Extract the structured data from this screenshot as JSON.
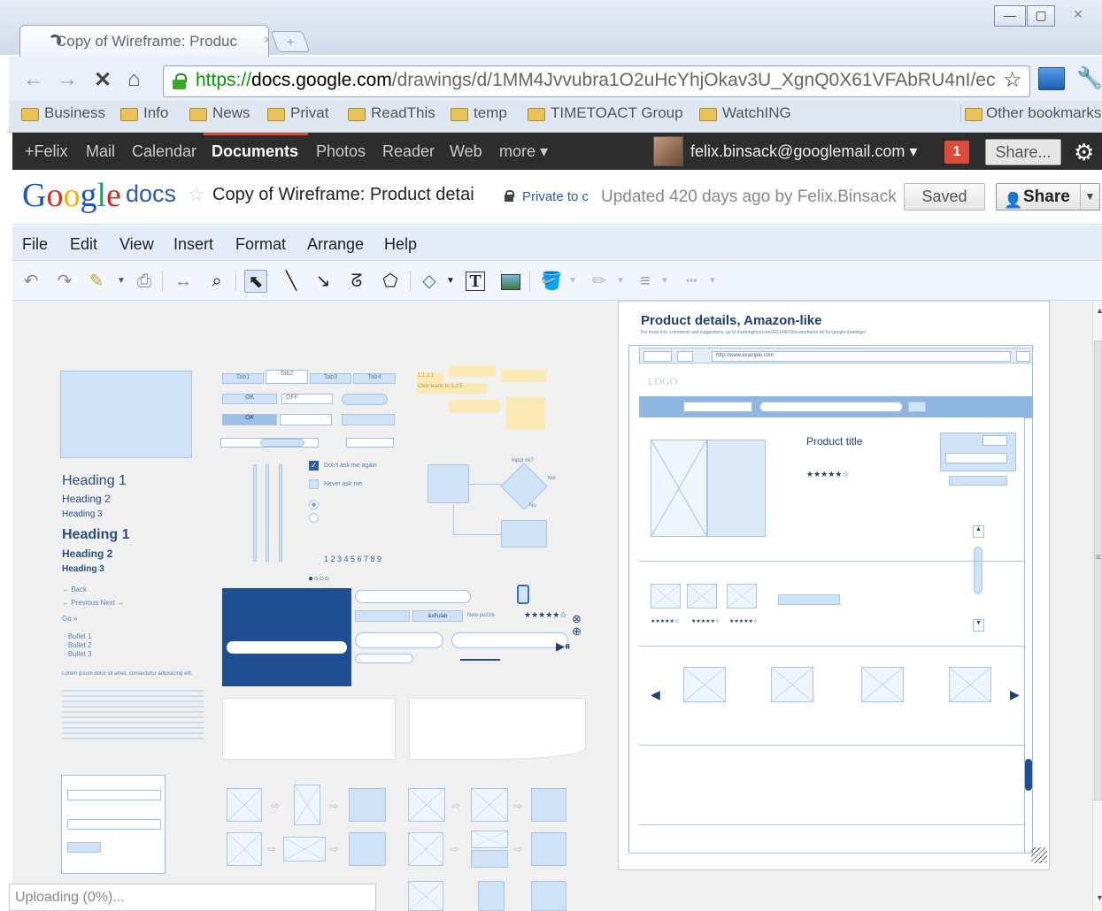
{
  "browser": {
    "tab_title": "Copy of Wireframe: Produc",
    "tab_close": "×",
    "new_tab": "+",
    "window_buttons": [
      "—",
      "▢",
      "✕"
    ],
    "url_scheme": "https://",
    "url_host": "docs.google.com",
    "url_path": "/drawings/d/1MM4Jvvubra1O2uHcYhjOkav3U_XgnQ0X61VFAbRU4nI/ec",
    "nav_icons": [
      "back-icon",
      "forward-icon",
      "stop-icon",
      "home-icon"
    ],
    "bookmarks": [
      "Business",
      "Info",
      "News",
      "Privat",
      "ReadThis",
      "temp",
      "TIMETOACT Group",
      "WatchING"
    ],
    "other_bookmarks": "Other bookmarks"
  },
  "gbar": {
    "links": [
      "+Felix",
      "Mail",
      "Calendar",
      "Documents",
      "Photos",
      "Reader",
      "Web",
      "more ▾"
    ],
    "active": "Documents",
    "user": "felix.binsack@googlemail.com ▾",
    "notifications": "1",
    "share": "Share..."
  },
  "docheader": {
    "logo": [
      "G",
      "o",
      "o",
      "g",
      "l",
      "e"
    ],
    "product": "docs",
    "title": "Copy of Wireframe: Product detai",
    "privacy": "Private to c",
    "updated": "Updated 420 days ago by Felix.Binsack",
    "saved": "Saved",
    "share": "Share"
  },
  "menu": [
    "File",
    "Edit",
    "View",
    "Insert",
    "Format",
    "Arrange",
    "Help"
  ],
  "toolbar_icons": [
    "undo-icon",
    "redo-icon",
    "paint-format-icon",
    "print-icon",
    "fit-icon",
    "zoom-icon",
    "select-icon",
    "line-icon",
    "arrow-icon",
    "curve-icon",
    "polyline-icon",
    "shape-icon",
    "textbox-icon",
    "image-icon",
    "fill-color-icon",
    "line-color-icon",
    "line-weight-icon",
    "line-dash-icon"
  ],
  "palette": {
    "tabs": [
      "Tab1",
      "Tab2",
      "Tab3",
      "Tab4"
    ],
    "ok": "OK",
    "off": "OFF",
    "note": "1.1.1.1",
    "note2": "Click leads to 1.3.5",
    "checkbox1": "Don't ask me again",
    "checkbox2": "Never ask me",
    "pagination": "1 2 3 4 5 6 7 8 9",
    "input_q": "Input ok?",
    "yes": "Yes",
    "no": "No",
    "headings_light": [
      "Heading 1",
      "Heading 2",
      "Heading 3"
    ],
    "headings_bold": [
      "Heading 1",
      "Heading 2",
      "Heading 3"
    ],
    "back": "← Back",
    "prevnext": "← Previous   Next →",
    "go": "Go »",
    "bullets": [
      "· Bullet 1",
      "· Bullet 2",
      "· Bullet 3"
    ],
    "lorem": "Lorem ipsum dolor sit amet, consectetur adipisicing elit.",
    "button_label": "&xFulab",
    "new_puzzle": "New puzzle",
    "stars": "★★★★★☆"
  },
  "wireframe": {
    "title": "Product details, Amazon-like",
    "subtitle": "For more info, comments and suggestions, go to mockingbird.com/2011/06/19/a-wireframe-kit-for-google-drawings/",
    "url": "http://www.example.com",
    "logo": "LOGO",
    "product_title": "Product title",
    "rating": "★★★★★☆",
    "small_rating": "★★★★★☆"
  },
  "status": "Uploading (0%)..."
}
